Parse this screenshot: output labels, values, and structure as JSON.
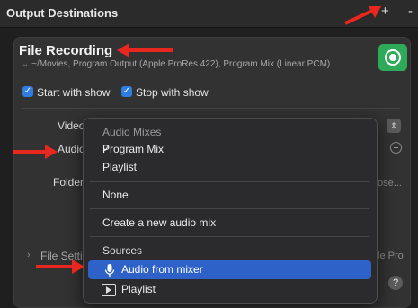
{
  "header": {
    "title": "Output Destinations",
    "add_label": "+",
    "remove_label": "-"
  },
  "recording": {
    "title": "File Recording",
    "subtitle": "~/Movies, Program Output (Apple ProRes 422), Program Mix (Linear PCM)",
    "start_with_show": "Start with show",
    "stop_with_show": "Stop with show"
  },
  "fields": {
    "video_label": "Video",
    "audio_label": "Audio",
    "folder_label": "Folder",
    "folder_button_partial": "ose...",
    "file_settings_label": "File Setti",
    "file_settings_value_partial": "le Pro"
  },
  "menu": {
    "section_audio_mixes": "Audio Mixes",
    "program_mix": "Program Mix",
    "playlist": "Playlist",
    "none": "None",
    "create_new_mix": "Create a new audio mix",
    "section_sources": "Sources",
    "audio_from_mixer": "Audio from mixer",
    "playlist_source": "Playlist"
  },
  "colors": {
    "accent": "#2e62c8",
    "record": "#2faa58",
    "annotation": "#e8281e"
  },
  "icons": [
    "record-icon",
    "checkmark-icon",
    "microphone-icon",
    "playlist-icon",
    "help-icon",
    "chevron-right-icon"
  ]
}
